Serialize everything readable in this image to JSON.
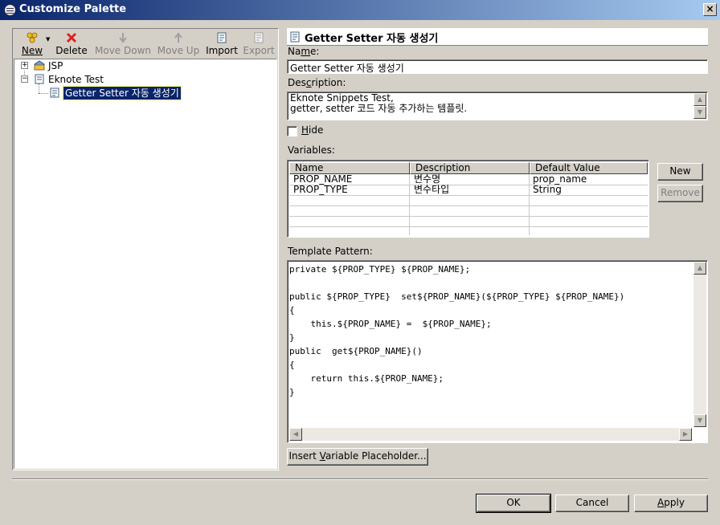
{
  "window": {
    "title": "Customize Palette",
    "close_glyph": "×"
  },
  "toolbar": {
    "new_label": "New",
    "delete_label": "Delete",
    "move_down_label": "Move Down",
    "move_up_label": "Move Up",
    "import_label": "Import",
    "export_label": "Export"
  },
  "tree": {
    "items": [
      {
        "label": "JSP",
        "expanded": false
      },
      {
        "label": "Eknote Test",
        "expanded": true
      },
      {
        "label": "Getter Setter  자동 생성기",
        "selected": true
      }
    ]
  },
  "editor": {
    "header_title": "Getter Setter  자동 생성기",
    "name_label": "Name:",
    "name_value": "Getter Setter  자동 생성기",
    "description_label": "Description:",
    "description_line1": "Eknote Snippets Test,",
    "description_line2": "getter, setter 코드 자동 추가하는 템플릿.",
    "hide_label": "Hide",
    "hide_checked": false,
    "variables_label": "Variables:",
    "variables_columns": [
      "Name",
      "Description",
      "Default Value"
    ],
    "variables_rows": [
      [
        "PROP_NAME",
        "변수명",
        "prop_name"
      ],
      [
        "PROP_TYPE",
        "변수타입",
        "String"
      ]
    ],
    "new_var_button": "New",
    "remove_var_button": "Remove",
    "template_label": "Template Pattern:",
    "template_lines": [
      "private ${PROP_TYPE} ${PROP_NAME};",
      "",
      "public ${PROP_TYPE}  set${PROP_NAME}(${PROP_TYPE} ${PROP_NAME})",
      "{",
      "    this.${PROP_NAME} =  ${PROP_NAME};",
      "}",
      "public  get${PROP_NAME}()",
      "{",
      "    return this.${PROP_NAME};",
      "}"
    ],
    "insert_placeholder_button": "Insert Variable Placeholder..."
  },
  "footer": {
    "ok_label": "OK",
    "cancel_label": "Cancel",
    "apply_label": "Apply"
  },
  "colors": {
    "face": "#d4d0c8",
    "title_start": "#0a246a",
    "title_end": "#a6caf0",
    "selection": "#0a246a",
    "delete_red": "#e02020"
  }
}
